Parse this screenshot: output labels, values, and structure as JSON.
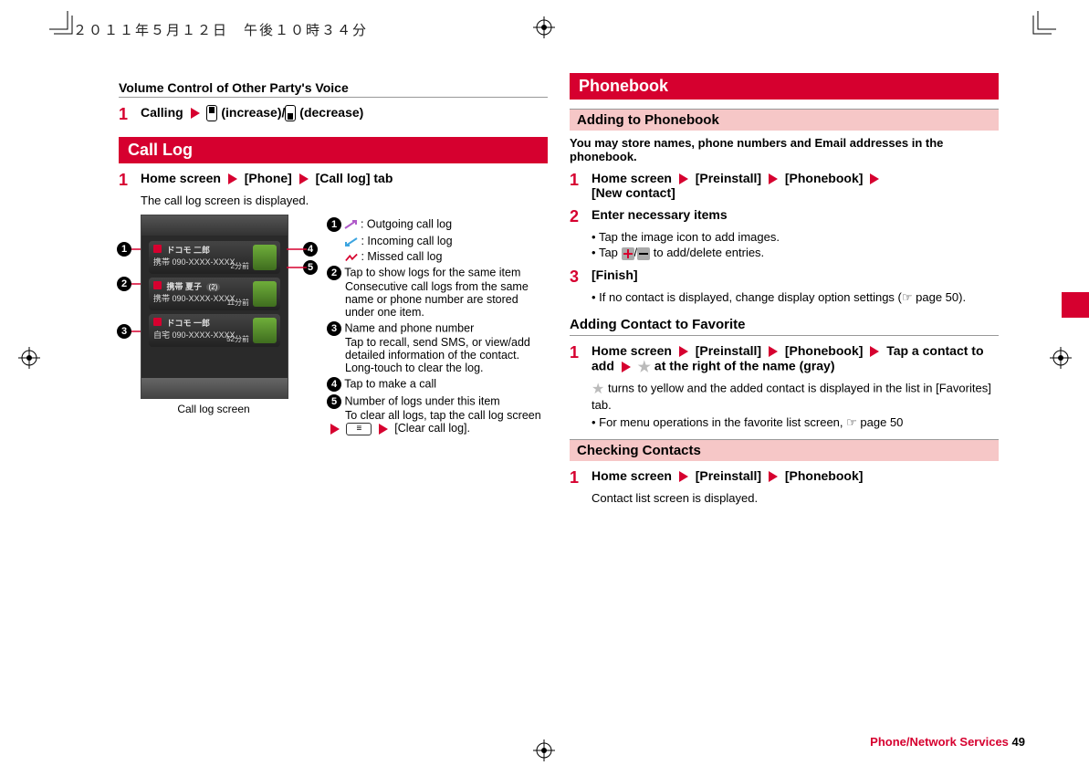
{
  "header_date": "２０１１年５月１２日　午後１０時３４分",
  "left": {
    "volume_heading": "Volume Control of Other Party's Voice",
    "step1_prefix": "Calling",
    "vol_increase": "(increase)/",
    "vol_decrease": "(decrease)",
    "call_log_bar": "Call Log",
    "call_log_step_prefix": "Home screen",
    "call_log_phone": "[Phone]",
    "call_log_tab": "[Call log] tab",
    "call_log_desc": "The call log screen is displayed.",
    "caption": "Call log screen",
    "legend": {
      "l1a": ": Outgoing call log",
      "l1b": ": Incoming call log",
      "l1c": ": Missed call log",
      "l2a": "Tap to show logs for the same item",
      "l2b": "Consecutive call logs from the same name or phone number are stored under one item.",
      "l3a": "Name and phone number",
      "l3b": "Tap to recall, send SMS, or view/add detailed information of the contact.",
      "l3c": "Long-touch to clear the log.",
      "l4": "Tap to make a call",
      "l5a": "Number of logs under this item",
      "l5b": "To clear all logs, tap the call log screen ",
      "l5c": "[Clear call log]."
    },
    "phone_rows": [
      {
        "name": "ドコモ 二郎",
        "sub": "携帯 090-XXXX-XXXX",
        "meta": "2分前"
      },
      {
        "name": "携帯 夏子",
        "sub": "携帯 090-XXXX-XXXX",
        "badge": "(2)",
        "meta": "11分前"
      },
      {
        "name": "ドコモ 一郎",
        "sub": "自宅 090-XXXX-XXXX",
        "meta": "52分前"
      }
    ]
  },
  "right": {
    "phonebook_bar": "Phonebook",
    "adding_bar": "Adding to Phonebook",
    "intro": "You may store names, phone numbers and Email addresses in the phonebook.",
    "s1_prefix": "Home screen",
    "s1_preinstall": "[Preinstall]",
    "s1_phonebook": "[Phonebook]",
    "s1_newcontact": "[New contact]",
    "s2": "Enter necessary items",
    "s2_b1": "Tap the image icon to add images.",
    "s2_b2_a": "Tap ",
    "s2_b2_b": " to add/delete entries.",
    "s3": "[Finish]",
    "s3_b1_a": "If no contact is displayed, change display option settings (",
    "s3_b1_b": " page 50).",
    "fav_bar": "Adding Contact to Favorite",
    "fav_s1_prefix": "Home screen",
    "fav_s1_tap": "Tap a contact to add",
    "fav_s1_at": " at the right of the name (gray)",
    "fav_desc_a": " turns to yellow and the added contact is displayed in the list in [Favorites] tab.",
    "fav_desc_b": "For menu operations in the favorite list screen, ",
    "fav_desc_c": " page 50",
    "check_bar": "Checking Contacts",
    "check_s1_prefix": "Home screen",
    "check_desc": "Contact list screen is displayed."
  },
  "footer": {
    "section": "Phone/Network Services",
    "page": "49"
  }
}
